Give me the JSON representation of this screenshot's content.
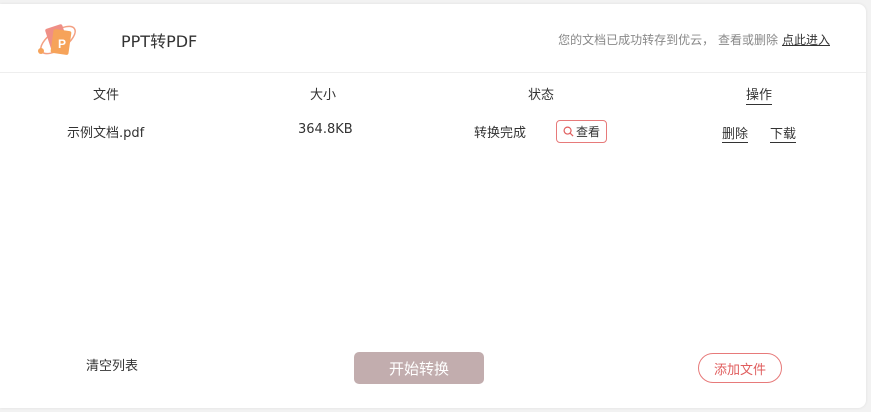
{
  "header": {
    "title": "PPT转PDF",
    "notice": "您的文档已成功转存到优云， 查看或删除",
    "notice_link": "点此进入"
  },
  "table": {
    "columns": [
      "文件",
      "大小",
      "状态",
      "操作"
    ],
    "rows": [
      {
        "file": "示例文档.pdf",
        "size": "364.8KB",
        "status": "转换完成",
        "view_label": "查看",
        "delete_label": "删除",
        "download_label": "下载"
      }
    ]
  },
  "footer": {
    "clear_label": "清空列表",
    "start_label": "开始转换",
    "add_label": "添加文件"
  },
  "colors": {
    "accent": "#e77a7a",
    "start_button": "#c2adae"
  }
}
